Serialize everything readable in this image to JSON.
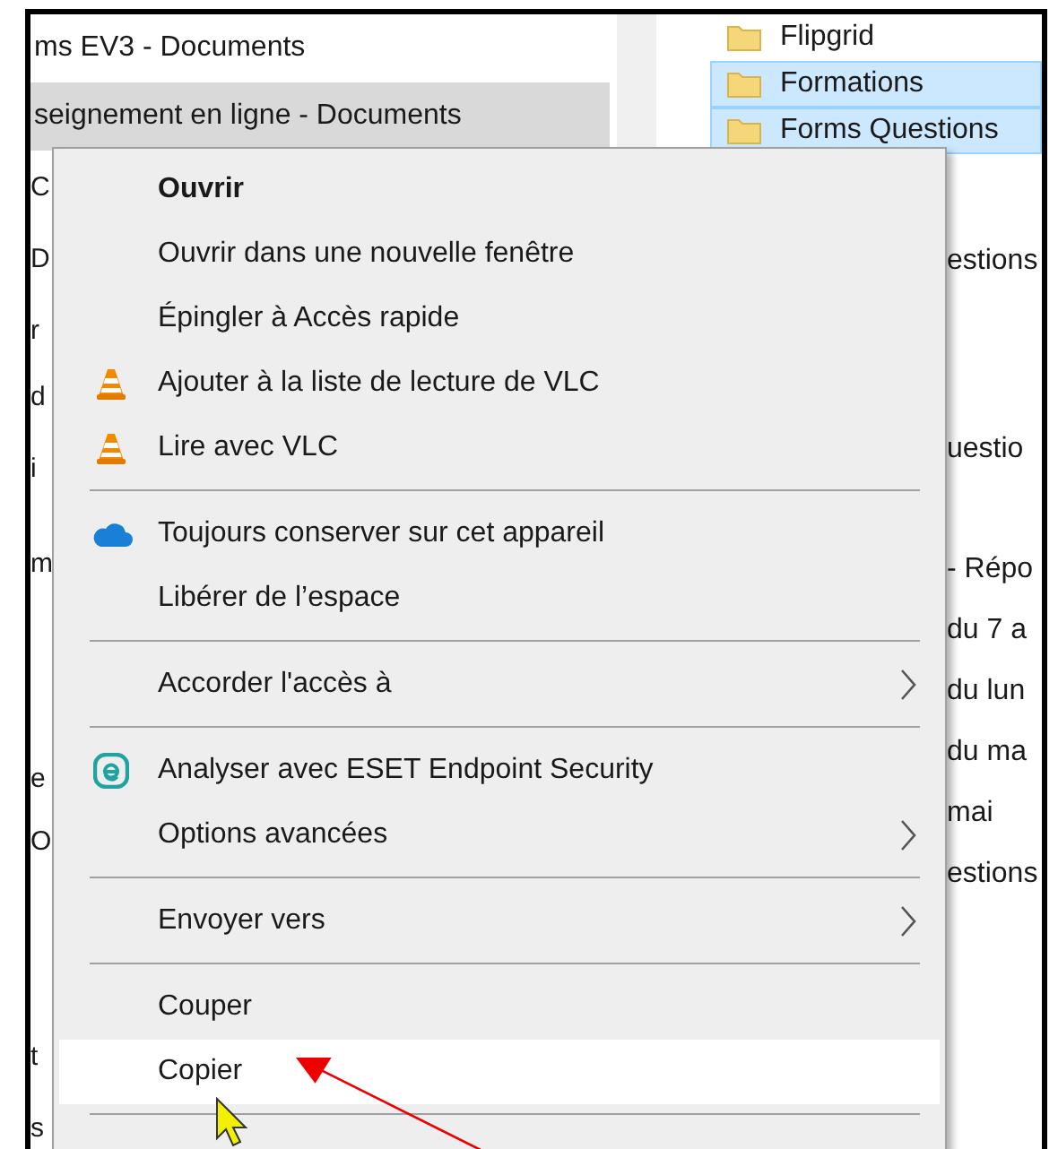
{
  "left_pane": {
    "rows": [
      {
        "name": "ms EV3 - Documents",
        "selected": false
      },
      {
        "name": "seignement en ligne - Documents",
        "selected": true
      }
    ],
    "fragments": [
      "C",
      "D",
      "r",
      "d",
      "i",
      "m",
      "e",
      "O",
      "t",
      "s"
    ]
  },
  "right_pane": {
    "folders": [
      {
        "name": "Flipgrid",
        "selected": false
      },
      {
        "name": "Formations",
        "selected": true
      },
      {
        "name": "Forms Questions",
        "selected": true
      }
    ],
    "fragments": [
      "estions",
      "uestio",
      "- Répo",
      "du 7 a",
      "du lun",
      "du ma",
      "mai",
      "estions"
    ]
  },
  "context_menu": {
    "items": [
      {
        "kind": "default",
        "label": "Ouvrir",
        "selected": false
      },
      {
        "kind": "plain",
        "label": "Ouvrir dans une nouvelle fenêtre",
        "selected": false
      },
      {
        "kind": "plain",
        "label": "Épingler à Accès rapide",
        "selected": false
      },
      {
        "kind": "cone",
        "label": "Ajouter à la liste de lecture de VLC",
        "selected": false
      },
      {
        "kind": "cone",
        "label": "Lire avec VLC",
        "selected": false
      },
      {
        "kind": "separator"
      },
      {
        "kind": "cloud",
        "label": "Toujours conserver sur cet appareil",
        "selected": false
      },
      {
        "kind": "plain",
        "label": "Libérer de l’espace",
        "selected": false
      },
      {
        "kind": "separator"
      },
      {
        "kind": "submenu",
        "label": "Accorder l'accès à",
        "selected": false
      },
      {
        "kind": "separator"
      },
      {
        "kind": "badge",
        "label": "Analyser avec ESET Endpoint Security",
        "selected": false
      },
      {
        "kind": "submenu",
        "label": "Options avancées",
        "selected": false
      },
      {
        "kind": "separator"
      },
      {
        "kind": "submenu",
        "label": "Envoyer vers",
        "selected": false
      },
      {
        "kind": "separator"
      },
      {
        "kind": "plain",
        "label": "Couper",
        "selected": false
      },
      {
        "kind": "plain",
        "label": "Copier",
        "selected": true
      },
      {
        "kind": "separator"
      }
    ]
  }
}
